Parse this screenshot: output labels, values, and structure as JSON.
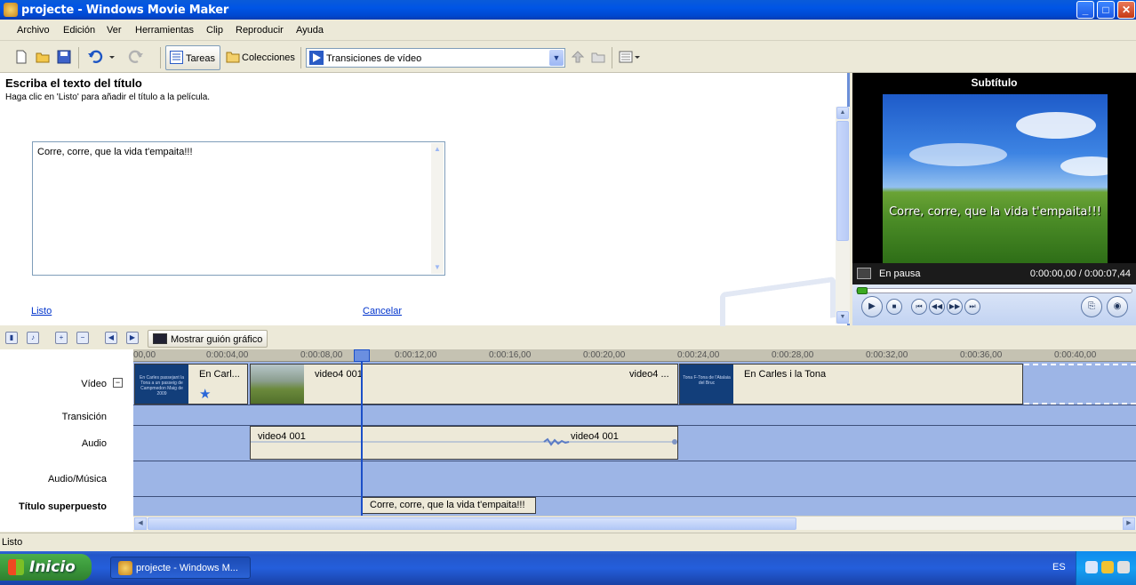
{
  "window": {
    "title": "projecte - Windows Movie Maker",
    "min_label": "_",
    "max_label": "□",
    "close_label": "✕"
  },
  "menu": [
    "Archivo",
    "Edición",
    "Ver",
    "Herramientas",
    "Clip",
    "Reproducir",
    "Ayuda"
  ],
  "toolbar": {
    "tasks_label": "Tareas",
    "collections_label": "Colecciones",
    "collection_combo_value": "Transiciones de vídeo"
  },
  "taskpane": {
    "heading": "Escriba el texto del título",
    "instructions": "Haga clic en 'Listo' para añadir el título a la película.",
    "title_text": "Corre, corre, que la vida t'empaita!!!",
    "done_link": "Listo",
    "cancel_link": "Cancelar"
  },
  "preview": {
    "heading": "Subtítulo",
    "caption": "Corre, corre, que la vida t'empaita!!!",
    "status": "En pausa",
    "time": "0:00:00,00 / 0:00:07,44"
  },
  "storyboard": {
    "toggle_label": "Mostrar guión gráfico"
  },
  "timeline": {
    "ruler_ticks": [
      "00,00",
      "0:00:04,00",
      "0:00:08,00",
      "0:00:12,00",
      "0:00:16,00",
      "0:00:20,00",
      "0:00:24,00",
      "0:00:28,00",
      "0:00:32,00",
      "0:00:36,00",
      "0:00:40,00"
    ],
    "track_labels": {
      "video": "Vídeo",
      "transition": "Transición",
      "audio": "Audio",
      "music": "Audio/Música",
      "overlay": "Título superpuesto"
    },
    "video_clips": [
      "En Carl...",
      "video4 001",
      "video4 ...",
      "En Carles i la Tona"
    ],
    "thumb1_text": "En Carles passejant la Tona a un passeig de Campmedon Maig de 2009",
    "thumb3_text": "Tona F-Tona de l'Atalaia del Bruc",
    "audio_clips": [
      "video4 001",
      "video4 001"
    ],
    "overlay_clip": "Corre, corre, que la vida t'empaita!!!"
  },
  "statusbar": {
    "text": "Listo"
  },
  "taskbar": {
    "start_label": "Inicio",
    "task_label": "projecte - Windows M...",
    "language": "ES"
  }
}
